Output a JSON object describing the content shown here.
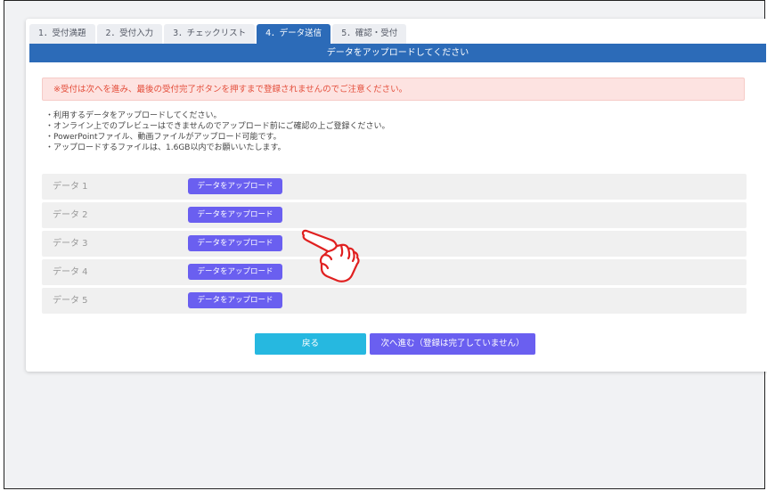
{
  "tabs": [
    {
      "label": "1．受付満題",
      "active": false
    },
    {
      "label": "2．受付入力",
      "active": false
    },
    {
      "label": "3．チェックリスト",
      "active": false
    },
    {
      "label": "4．データ送信",
      "active": true
    },
    {
      "label": "5．確認・受付",
      "active": false
    }
  ],
  "header": {
    "title": "データをアップロードしてください"
  },
  "alert": {
    "text": "※受付は次へを進み、最後の受付完了ボタンを押すまで登録されませんのでご注意ください。"
  },
  "notes": [
    "・利用するデータをアップロードしてください。",
    "・オンライン上でのプレビューはできませんのでアップロード前にご確認の上ご登録ください。",
    "・PowerPointファイル、動画ファイルがアップロード可能です。",
    "・アップロードするファイルは、1.6GB以内でお願いいたします。"
  ],
  "rows": [
    {
      "label": "データ 1",
      "button": "データをアップロード"
    },
    {
      "label": "データ 2",
      "button": "データをアップロード"
    },
    {
      "label": "データ 3",
      "button": "データをアップロード"
    },
    {
      "label": "データ 4",
      "button": "データをアップロード"
    },
    {
      "label": "データ 5",
      "button": "データをアップロード"
    }
  ],
  "actions": {
    "back_label": "戻る",
    "next_label": "次へ進む（登録は完了していません）"
  },
  "colors": {
    "primary": "#2c6bb8",
    "upload": "#6a5ff0",
    "back": "#26b8e0",
    "alert_text": "#e44d3a",
    "alert_bg": "#fde3e1",
    "pointer": "#e02020"
  },
  "icons": {
    "pointer": "pointing-hand-icon"
  }
}
